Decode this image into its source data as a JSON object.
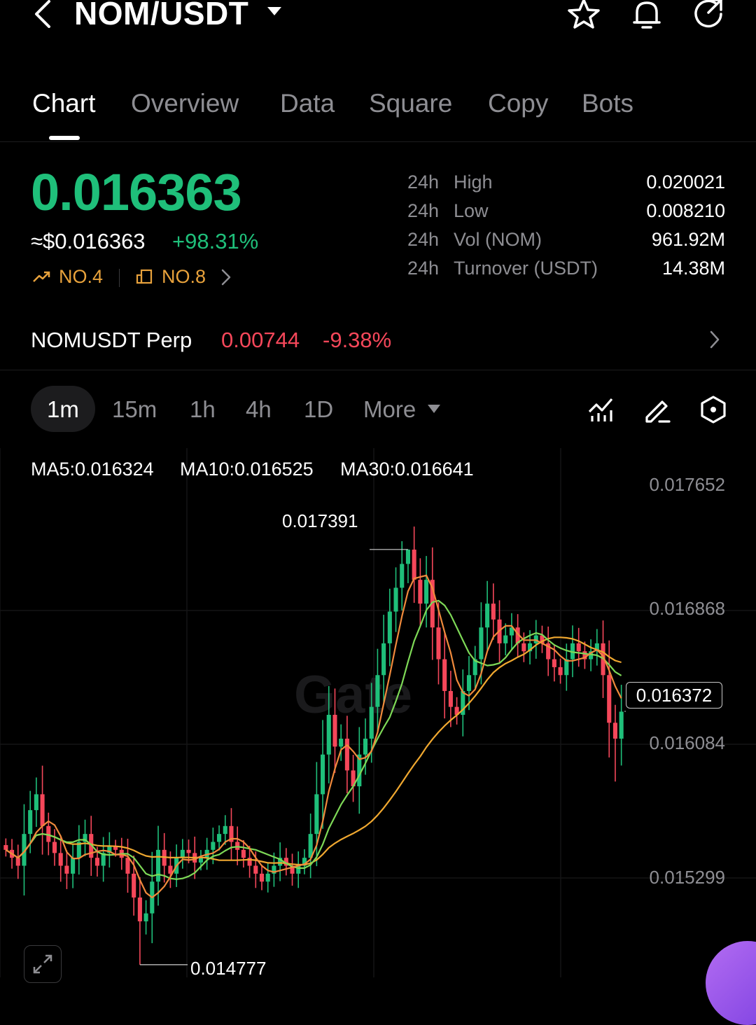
{
  "header": {
    "pair": "NOM/USDT",
    "icons": [
      "back-icon",
      "caret-down-icon",
      "star-icon",
      "bell-icon",
      "share-icon"
    ]
  },
  "tabs": [
    "Chart",
    "Overview",
    "Data",
    "Square",
    "Copy",
    "Bots"
  ],
  "price": {
    "last": "0.016363",
    "usd": "≈$0.016363",
    "change_pct": "+98.31%",
    "rank1": "NO.4",
    "rank2": "NO.8",
    "up_color": "#1fbf7a",
    "down_color": "#f5475a"
  },
  "stats": [
    {
      "period": "24h",
      "label": "High",
      "value": "0.020021"
    },
    {
      "period": "24h",
      "label": "Low",
      "value": "0.008210"
    },
    {
      "period": "24h",
      "label": "Vol (NOM)",
      "value": "961.92M"
    },
    {
      "period": "24h",
      "label": "Turnover (USDT)",
      "value": "14.38M"
    }
  ],
  "perp": {
    "name": "NOMUSDT Perp",
    "price": "0.00744",
    "change": "-9.38%"
  },
  "intervals": [
    "1m",
    "15m",
    "1h",
    "4h",
    "1D"
  ],
  "interval_more": "More",
  "interval_selected": "1m",
  "indicators": {
    "ma5": "MA5:0.016324",
    "ma10": "MA10:0.016525",
    "ma30": "MA30:0.016641",
    "ma5_color": "#f08a3c",
    "ma10_color": "#7ed957",
    "ma30_color": "#f0a830"
  },
  "chart_data": {
    "type": "candlestick",
    "interval": "1m",
    "y_ticks": [
      "0.017652",
      "0.016868",
      "0.016084",
      "0.015299"
    ],
    "ylim": [
      0.01475,
      0.0178
    ],
    "high_label": "0.017391",
    "low_label": "0.014777",
    "current_label": "0.016372",
    "watermark": "Gate",
    "close": [
      0.0155,
      0.01545,
      0.0154,
      0.0156,
      0.01575,
      0.01585,
      0.01565,
      0.01555,
      0.01548,
      0.0154,
      0.01535,
      0.01545,
      0.01555,
      0.0156,
      0.01545,
      0.0154,
      0.01548,
      0.01552,
      0.0155,
      0.01545,
      0.01535,
      0.0152,
      0.01505,
      0.0151,
      0.0153,
      0.0155,
      0.0154,
      0.01535,
      0.01545,
      0.0155,
      0.01548,
      0.01542,
      0.01545,
      0.0155,
      0.01555,
      0.0156,
      0.01565,
      0.01555,
      0.0155,
      0.01545,
      0.0154,
      0.01535,
      0.0153,
      0.01535,
      0.0154,
      0.01545,
      0.0154,
      0.01535,
      0.0154,
      0.01545,
      0.0156,
      0.01585,
      0.0161,
      0.01635,
      0.01615,
      0.0162,
      0.016,
      0.0159,
      0.0161,
      0.0162,
      0.0164,
      0.0166,
      0.0168,
      0.017,
      0.01715,
      0.0173,
      0.01739,
      0.0172,
      0.01705,
      0.0172,
      0.0169,
      0.0167,
      0.0165,
      0.0164,
      0.01635,
      0.0165,
      0.0166,
      0.0167,
      0.0169,
      0.01705,
      0.01695,
      0.0168,
      0.01685,
      0.0169,
      0.0168,
      0.01675,
      0.0168,
      0.01685,
      0.0168,
      0.0167,
      0.01665,
      0.0166,
      0.0167,
      0.0168,
      0.01675,
      0.0167,
      0.01675,
      0.0168,
      0.0166,
      0.0163,
      0.0162,
      0.01637
    ]
  },
  "tools": [
    "indicator-icon",
    "draw-icon",
    "settings-hex-icon",
    "expand-icon"
  ]
}
